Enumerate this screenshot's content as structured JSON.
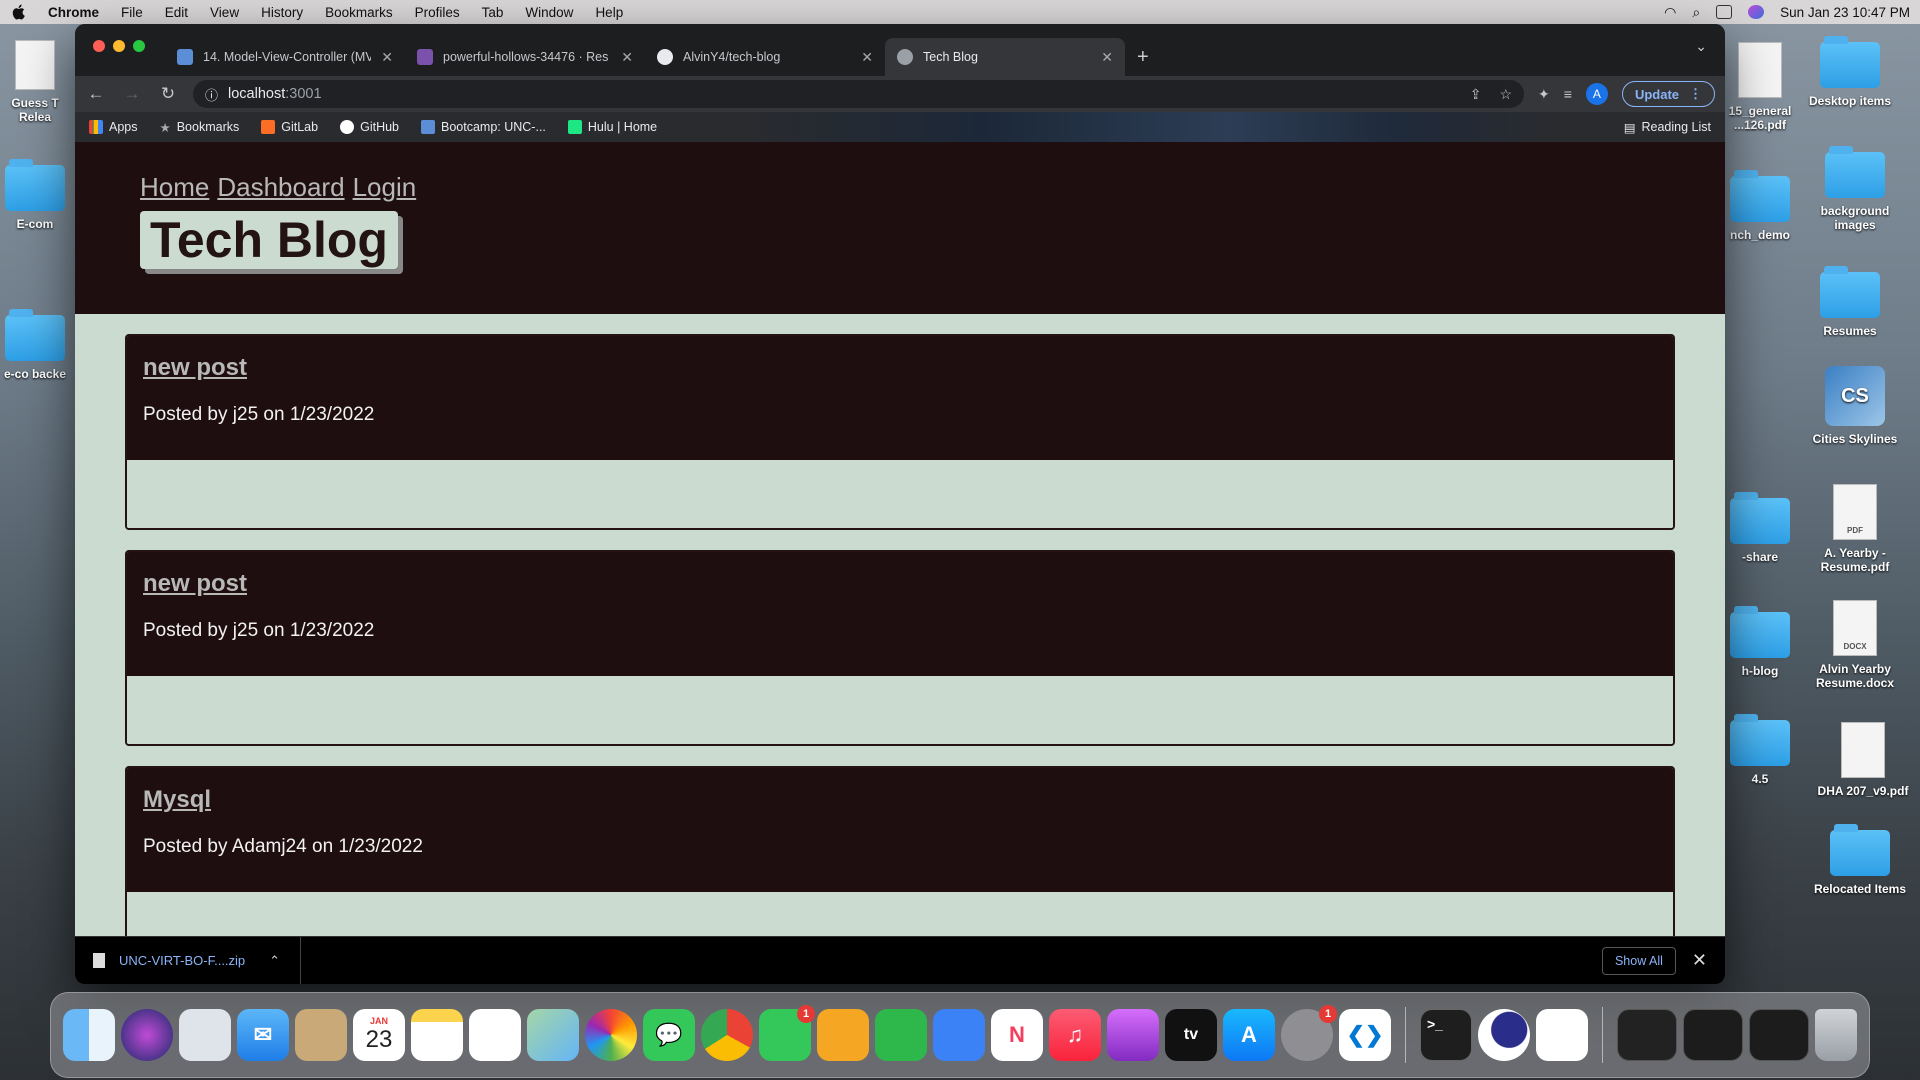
{
  "menubar": {
    "app_name": "Chrome",
    "items": [
      "File",
      "Edit",
      "View",
      "History",
      "Bookmarks",
      "Profiles",
      "Tab",
      "Window",
      "Help"
    ],
    "clock": "Sun Jan 23  10:47 PM"
  },
  "desktop": {
    "left_items": [
      "Guess T Relea",
      "E-com",
      "e-co backe"
    ],
    "right_items": [
      "Desktop items",
      "background images",
      "Resumes",
      "Cities Skylines",
      "A. Yearby - Resume.pdf",
      "Alvin Yearby Resume.docx",
      "DHA 207_v9.pdf",
      "Relocated Items"
    ],
    "partial_items": [
      "15_general ...126.pdf",
      "nch_demo",
      "-share",
      "h-blog",
      "4.5"
    ],
    "doc_labels": [
      "PDF",
      "DOCX"
    ],
    "app_icon_label": "CS"
  },
  "browser": {
    "tabs": [
      {
        "title": "14. Model-View-Controller (MV",
        "color": "#5b8ed6"
      },
      {
        "title": "powerful-hollows-34476 · Res",
        "color": "#7b52ab"
      },
      {
        "title": "AlvinY4/tech-blog",
        "color": "#e8eaed"
      },
      {
        "title": "Tech Blog",
        "color": "#9aa0a6"
      }
    ],
    "url_host": "localhost",
    "url_port": ":3001",
    "avatar_letter": "A",
    "update_label": "Update",
    "bookmarks": [
      "Apps",
      "Bookmarks",
      "GitLab",
      "GitHub",
      "Bootcamp: UNC-...",
      "Hulu | Home"
    ],
    "reading_list": "Reading List"
  },
  "site": {
    "nav": [
      "Home",
      "Dashboard",
      "Login"
    ],
    "brand": "Tech Blog",
    "posts": [
      {
        "title": "new post",
        "meta": "Posted by j25 on 1/23/2022"
      },
      {
        "title": "new post",
        "meta": "Posted by j25 on 1/23/2022"
      },
      {
        "title": "Mysql",
        "meta": "Posted by Adamj24 on 1/23/2022"
      }
    ],
    "colors": {
      "header_bg": "#1f0e10",
      "page_bg": "#ccdbd0"
    }
  },
  "download_bar": {
    "file_name": "UNC-VIRT-BO-F....zip",
    "show_all": "Show All"
  },
  "dock": {
    "calendar_month": "JAN",
    "calendar_day": "23",
    "facetime_badge": "1",
    "settings_badge": "1",
    "appletv_label": "tv"
  }
}
